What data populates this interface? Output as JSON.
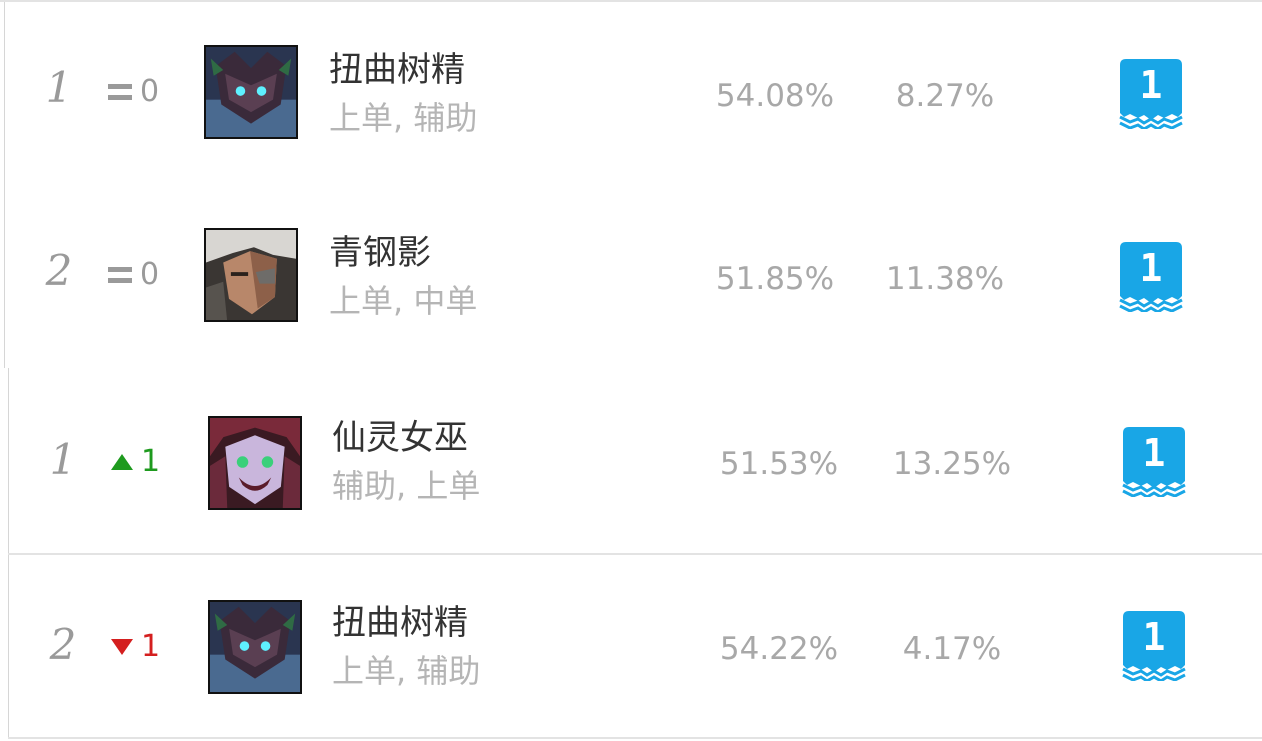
{
  "rows": [
    {
      "rank": "1",
      "change": {
        "direction": "same",
        "value": "0"
      },
      "portrait_icon": "twisted-treant-portrait",
      "name": "扭曲树精",
      "roles": "上单, 辅助",
      "win_rate": "54.08%",
      "pick_rate": "8.27%",
      "tier": "1"
    },
    {
      "rank": "2",
      "change": {
        "direction": "same",
        "value": "0"
      },
      "portrait_icon": "blade-shadow-portrait",
      "name": "青钢影",
      "roles": "上单, 中单",
      "win_rate": "51.85%",
      "pick_rate": "11.38%",
      "tier": "1"
    },
    {
      "rank": "1",
      "change": {
        "direction": "up",
        "value": "1"
      },
      "portrait_icon": "fae-sorceress-portrait",
      "name": "仙灵女巫",
      "roles": "辅助, 上单",
      "win_rate": "51.53%",
      "pick_rate": "13.25%",
      "tier": "1"
    },
    {
      "rank": "2",
      "change": {
        "direction": "down",
        "value": "1"
      },
      "portrait_icon": "twisted-treant-portrait",
      "name": "扭曲树精",
      "roles": "上单, 辅助",
      "win_rate": "54.22%",
      "pick_rate": "4.17%",
      "tier": "1"
    }
  ],
  "colors": {
    "tier_badge": "#19a6e6",
    "up": "#1e9a1e",
    "down": "#d41f1f",
    "muted": "#9a9a9a"
  }
}
